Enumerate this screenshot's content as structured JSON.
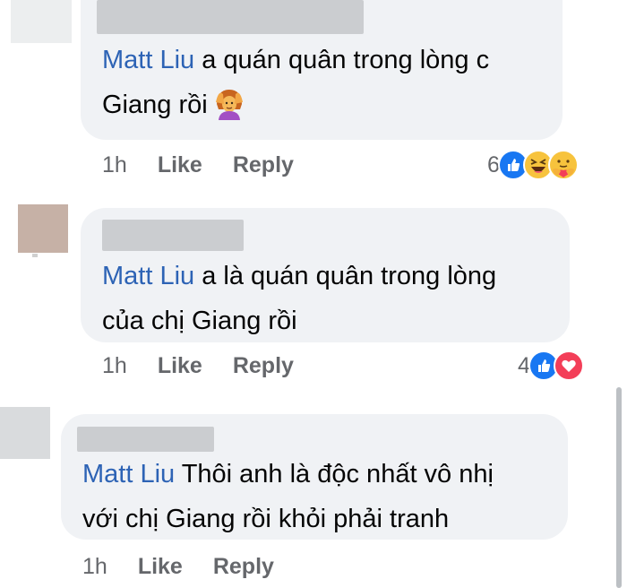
{
  "comments": [
    {
      "mention": "Matt Liu",
      "line1": " a quán quân trong lòng c",
      "line2": "Giang rồi",
      "emoji": "woman-gesturing-ok-emoji",
      "time": "1h",
      "like_label": "Like",
      "reply_label": "Reply",
      "reaction_count": "6",
      "reactions": [
        "like",
        "haha",
        "care"
      ]
    },
    {
      "mention": "Matt Liu",
      "line1": " a là quán quân trong lòng",
      "line2": "của chị Giang rồi",
      "time": "1h",
      "like_label": "Like",
      "reply_label": "Reply",
      "reaction_count": "4",
      "reactions": [
        "like",
        "love"
      ]
    },
    {
      "mention": "Matt Liu",
      "line1": " Thôi anh là độc nhất vô nhị",
      "line2": "với chị Giang rồi khỏi phải tranh",
      "time": "1h",
      "like_label": "Like",
      "reply_label": "Reply"
    }
  ],
  "colors": {
    "bubble": "#f0f2f5",
    "mention": "#2d63b5",
    "meta": "#65676b",
    "like": "#1877f2",
    "love": "#f33e58"
  }
}
